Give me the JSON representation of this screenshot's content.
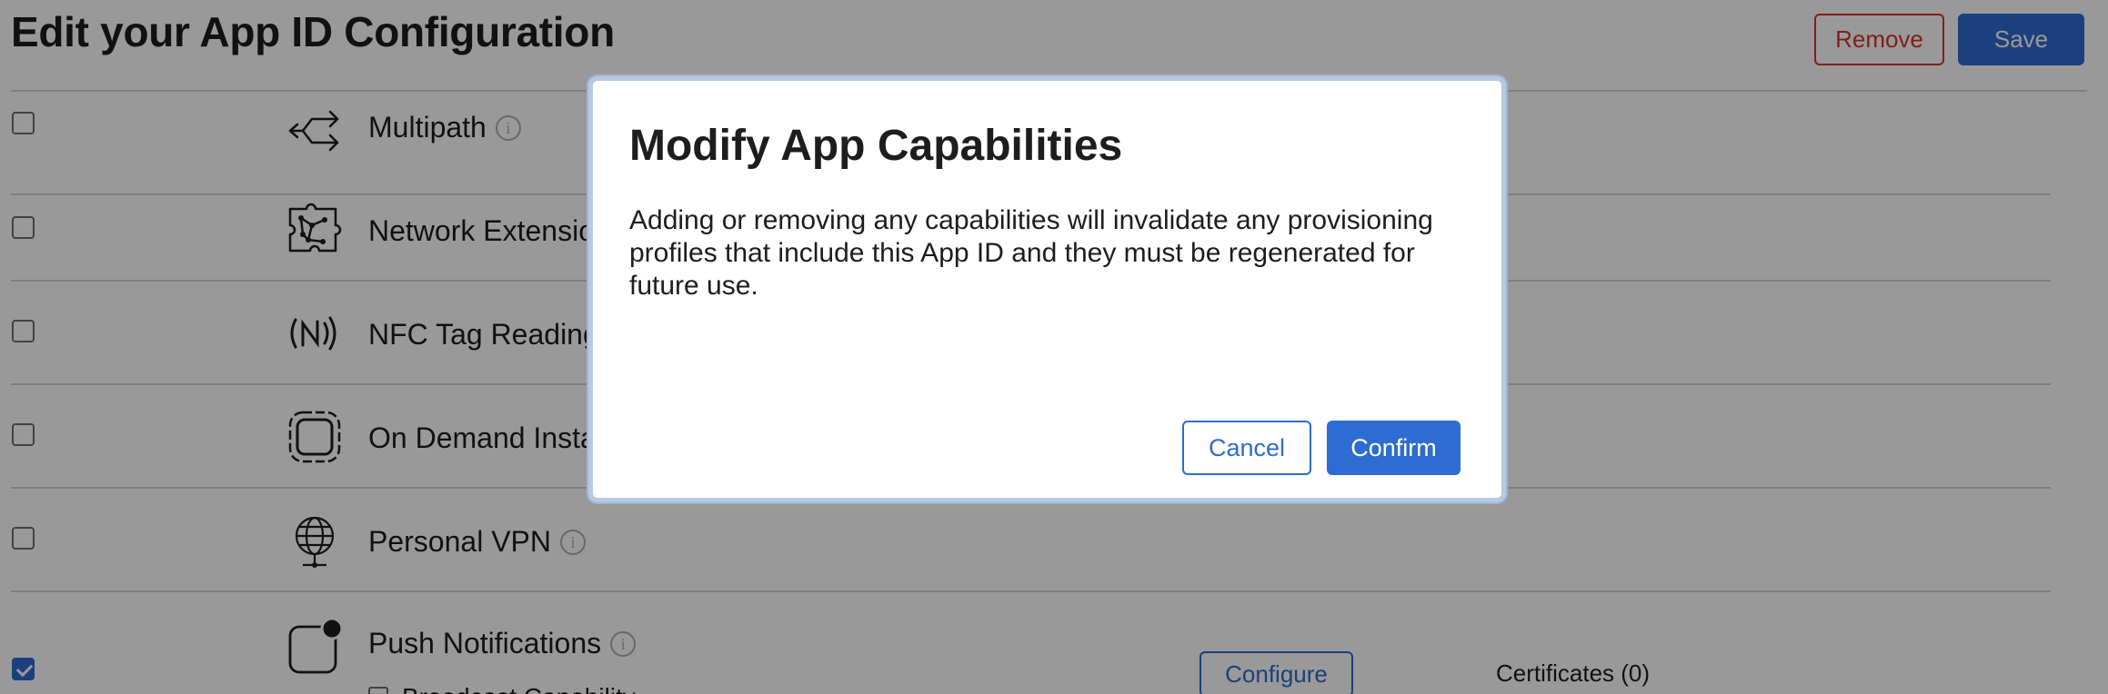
{
  "page": {
    "title": "Edit your App ID Configuration",
    "remove_label": "Remove",
    "save_label": "Save"
  },
  "capabilities": [
    {
      "label": "Multipath",
      "checked": false,
      "icon": "multipath-icon"
    },
    {
      "label": "Network Extensions",
      "checked": false,
      "icon": "network-extension-icon"
    },
    {
      "label": "NFC Tag Reading",
      "checked": false,
      "icon": "nfc-icon"
    },
    {
      "label": "On Demand Install Capable",
      "checked": false,
      "icon": "on-demand-icon"
    },
    {
      "label": "Personal VPN",
      "checked": false,
      "icon": "globe-icon"
    },
    {
      "label": "Push Notifications",
      "checked": true,
      "icon": "push-notification-icon"
    }
  ],
  "push": {
    "configure_label": "Configure",
    "certificates_label": "Certificates (0)",
    "sub_option_label": "Broadcast Capability"
  },
  "modal": {
    "title": "Modify App Capabilities",
    "body": "Adding or removing any capabilities will invalidate any provisioning profiles that include this App ID and they must be regenerated for future use.",
    "cancel_label": "Cancel",
    "confirm_label": "Confirm"
  },
  "colors": {
    "accent": "#2d6cd1",
    "danger": "#d8322b",
    "overlay": "rgba(0,0,0,0.4)"
  }
}
